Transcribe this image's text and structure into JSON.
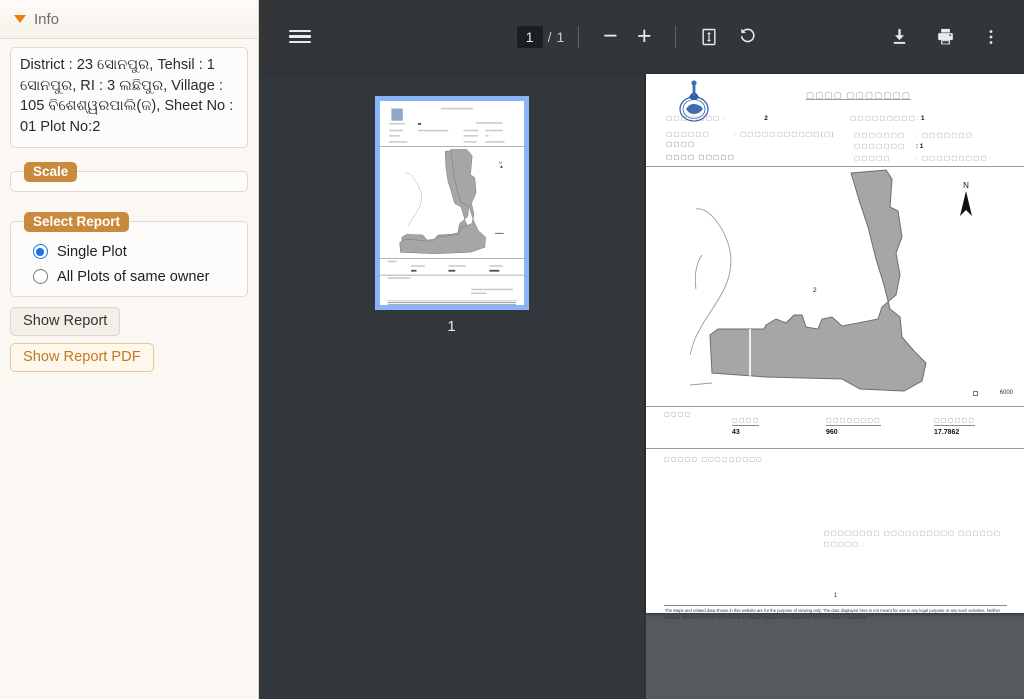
{
  "sidebar": {
    "header": {
      "title": "Info",
      "toggle_icon": "caret-down-icon"
    },
    "info_text": "District : 23 ସୋନପୁର, Tehsil : 1 ସୋନପୁର, RI : 3 ଲଛିପୁର, Village : 105 ବିଶେଶ୍ୱରପାଲି(ଜ), Sheet No : 01\nPlot No:2",
    "scale": {
      "legend": "Scale",
      "value": ""
    },
    "select_report": {
      "legend": "Select Report",
      "options": [
        {
          "label": "Single Plot",
          "selected": true
        },
        {
          "label": "All Plots of same owner",
          "selected": false
        }
      ]
    },
    "buttons": {
      "show_report": "Show Report",
      "show_report_pdf": "Show Report PDF"
    }
  },
  "toolbar": {
    "menu_icon": "hamburger-menu-icon",
    "page_current": "1",
    "page_separator": "/",
    "page_total": "1",
    "zoom_out": "−",
    "zoom_in": "+",
    "fit_icon": "fit-to-page-icon",
    "rotate_icon": "rotate-counterclockwise-icon",
    "download_icon": "download-icon",
    "print_icon": "print-icon",
    "more_icon": "more-vertical-icon"
  },
  "annotation": {
    "mark": "red-check-mark",
    "color": "#e11d16"
  },
  "thumbnails": {
    "items": [
      {
        "page_label": "1",
        "selected": true
      }
    ],
    "selected_color": "#8ab4f8"
  },
  "document": {
    "title_tofu": "▢▢▢▢ ▢▢▢▢▢▢▢",
    "emblem": "india-state-emblem",
    "header_left": [
      {
        "label": "▢▢▢ ▢▢▢▢ :",
        "value": "2"
      },
      {
        "label": "▢▢▢▢▢▢",
        "value": ": ▢▢▢▢▢▢▢▢▢▢▢(▢)"
      },
      {
        "label": "▢▢▢▢",
        "value": ""
      },
      {
        "label": "▢▢▢▢ ▢▢▢▢▢",
        "value": ""
      }
    ],
    "header_right_top": {
      "label": "▢▢▢▢▢▢▢▢▢:",
      "value": "1"
    },
    "header_right": [
      {
        "label": "▢▢▢▢▢▢▢",
        "value": ": ▢▢▢▢▢▢▢"
      },
      {
        "label": "▢▢▢▢▢▢▢",
        "value": ": 1"
      },
      {
        "label": "▢▢▢▢▢",
        "value": ": ▢▢▢▢▢▢▢▢▢"
      }
    ],
    "map": {
      "plot_label": "2",
      "compass_label": "N",
      "scale_value": "6000",
      "plot_fill": "#a6a6a6",
      "plot_stroke": "#6e6e6e"
    },
    "stats": {
      "section_label": "▢▢▢▢",
      "columns": [
        {
          "header": "▢▢▢▢",
          "value": "43"
        },
        {
          "header": "▢▢▢▢▢▢▢▢",
          "value": "960"
        },
        {
          "header": "▢▢▢▢▢▢",
          "value": "17.7862"
        }
      ],
      "sub_note": "▢▢▢▢▢ ▢▢▢▢▢▢▢▢▢"
    },
    "signature_block": "▢▢▢▢▢▢▢▢ ▢▢▢▢▢▢▢▢▢▢ ▢▢▢▢▢▢\n▢▢▢▢▢ :",
    "page_number": "1",
    "disclaimer": "The Maps and related data shown in this website are for the purpose of viewing only. The data displayed here is not meant for use in any legal purpose or any such activities. Neither National Informatics Centre nor Revenue & Disaster Management Department, Govt of Odisha is responsible"
  }
}
